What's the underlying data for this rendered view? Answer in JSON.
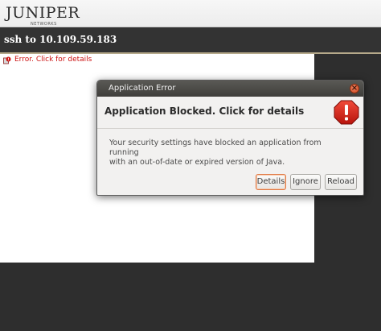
{
  "header": {
    "logo_text": "JUNIPER",
    "logo_sub": "NETWORKS"
  },
  "window": {
    "title": "ssh to 10.109.59.183"
  },
  "content": {
    "error_text": "Error. Click for details",
    "error_icon": "error-puzzle-icon"
  },
  "dialog": {
    "title": "Application Error",
    "heading": "Application Blocked. Click for details",
    "message_line1": "Your security settings have blocked an application from running",
    "message_line2": "with an out-of-date or expired version of Java.",
    "buttons": {
      "details": "Details",
      "ignore": "Ignore",
      "reload": "Reload"
    },
    "icons": {
      "close": "close-icon",
      "warning": "warning-stop-icon"
    }
  },
  "colors": {
    "error_red": "#cc1111",
    "title_bar": "#333333",
    "focus_orange": "#e07a46"
  }
}
